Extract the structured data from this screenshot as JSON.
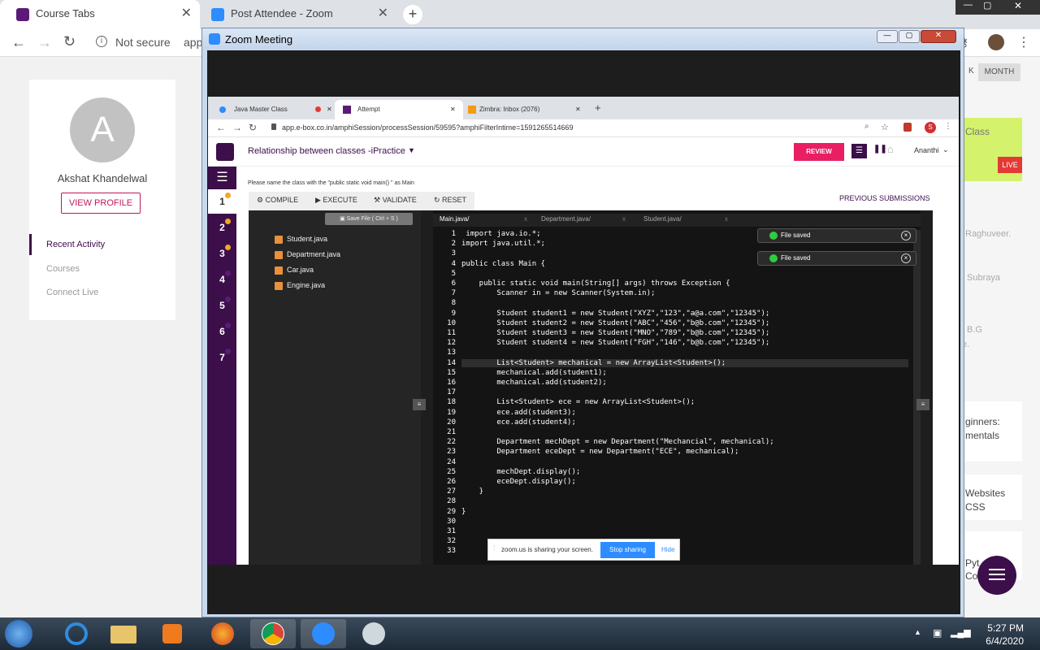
{
  "outer_tabs": [
    {
      "label": "Course Tabs"
    },
    {
      "label": "Post Attendee - Zoom"
    }
  ],
  "outer_address": {
    "security": "Not secure",
    "url_partial": "app"
  },
  "left_panel": {
    "avatar_letter": "A",
    "user_name": "Akshat Khandelwal",
    "view_profile": "VIEW PROFILE",
    "nav": [
      "Recent Activity",
      "Courses",
      "Connect Live"
    ]
  },
  "right_panel": {
    "month": "MONTH",
    "k": "K",
    "class_text": "Class",
    "live": "LIVE",
    "names": [
      "Raghuveer.",
      "Subraya",
      "B.G",
      "e."
    ],
    "courses": [
      {
        "l1": "ginners:",
        "l2": "mentals"
      },
      {
        "l1": "Websites",
        "l2": "CSS"
      },
      {
        "l1": "Pyt",
        "l2": "Co"
      }
    ]
  },
  "zoom": {
    "title": "Zoom Meeting"
  },
  "inner_tabs": [
    {
      "label": "Java Master Class"
    },
    {
      "label": "Attempt"
    },
    {
      "label": "Zimbra: Inbox (2076)"
    }
  ],
  "inner_url": "app.e-box.co.in/amphiSession/processSession/59595?amphiFilterIntime=1591265514669",
  "inner_profile_letter": "S",
  "header": {
    "title": "Relationship between classes -iPractice",
    "review": "REVIEW",
    "user": "Ananthi"
  },
  "question_numbers": [
    "1",
    "2",
    "3",
    "4",
    "5",
    "6",
    "7"
  ],
  "instruction": "Please name the class with the \"public static void main() \" as Main",
  "toolbar": {
    "compile": "COMPILE",
    "execute": "EXECUTE",
    "validate": "VALIDATE",
    "reset": "RESET",
    "previous": "PREVIOUS SUBMISSIONS"
  },
  "save_file": "Save File ( Ctrl + S )",
  "files": [
    "Student.java",
    "Department.java",
    "Car.java",
    "Engine.java"
  ],
  "editor_tabs": [
    "Main.java/",
    "Department.java/",
    "Student.java/"
  ],
  "editor_tab_close": "x",
  "toasts": [
    "File saved",
    "File saved"
  ],
  "code_lines": [
    " import java.io.*;",
    "import java.util.*;",
    "",
    "public class Main {",
    "",
    "    public static void main(String[] args) throws Exception {",
    "        Scanner in = new Scanner(System.in);",
    "",
    "        Student student1 = new Student(\"XYZ\",\"123\",\"a@a.com\",\"12345\");",
    "        Student student2 = new Student(\"ABC\",\"456\",\"b@b.com\",\"12345\");",
    "        Student student3 = new Student(\"MNO\",\"789\",\"b@b.com\",\"12345\");",
    "        Student student4 = new Student(\"FGH\",\"146\",\"b@b.com\",\"12345\");",
    "",
    "        List<Student> mechanical = new ArrayList<Student>();",
    "        mechanical.add(student1);",
    "        mechanical.add(student2);",
    "",
    "        List<Student> ece = new ArrayList<Student>();",
    "        ece.add(student3);",
    "        ece.add(student4);",
    "",
    "        Department mechDept = new Department(\"Mechancial\", mechanical);",
    "        Department eceDept = new Department(\"ECE\", mechanical);",
    "",
    "        mechDept.display();",
    "        eceDept.display();",
    "    }",
    "",
    "}",
    "",
    "",
    "",
    ""
  ],
  "share_bar": {
    "text": "zoom.us is sharing your screen.",
    "stop": "Stop sharing",
    "hide": "Hide"
  },
  "clock": {
    "time": "5:27 PM",
    "date": "6/4/2020"
  },
  "colors": {
    "purple": "#3c0f4a",
    "pink": "#e91e63",
    "zoom_blue": "#2d8cff",
    "live_red": "#e53935"
  }
}
